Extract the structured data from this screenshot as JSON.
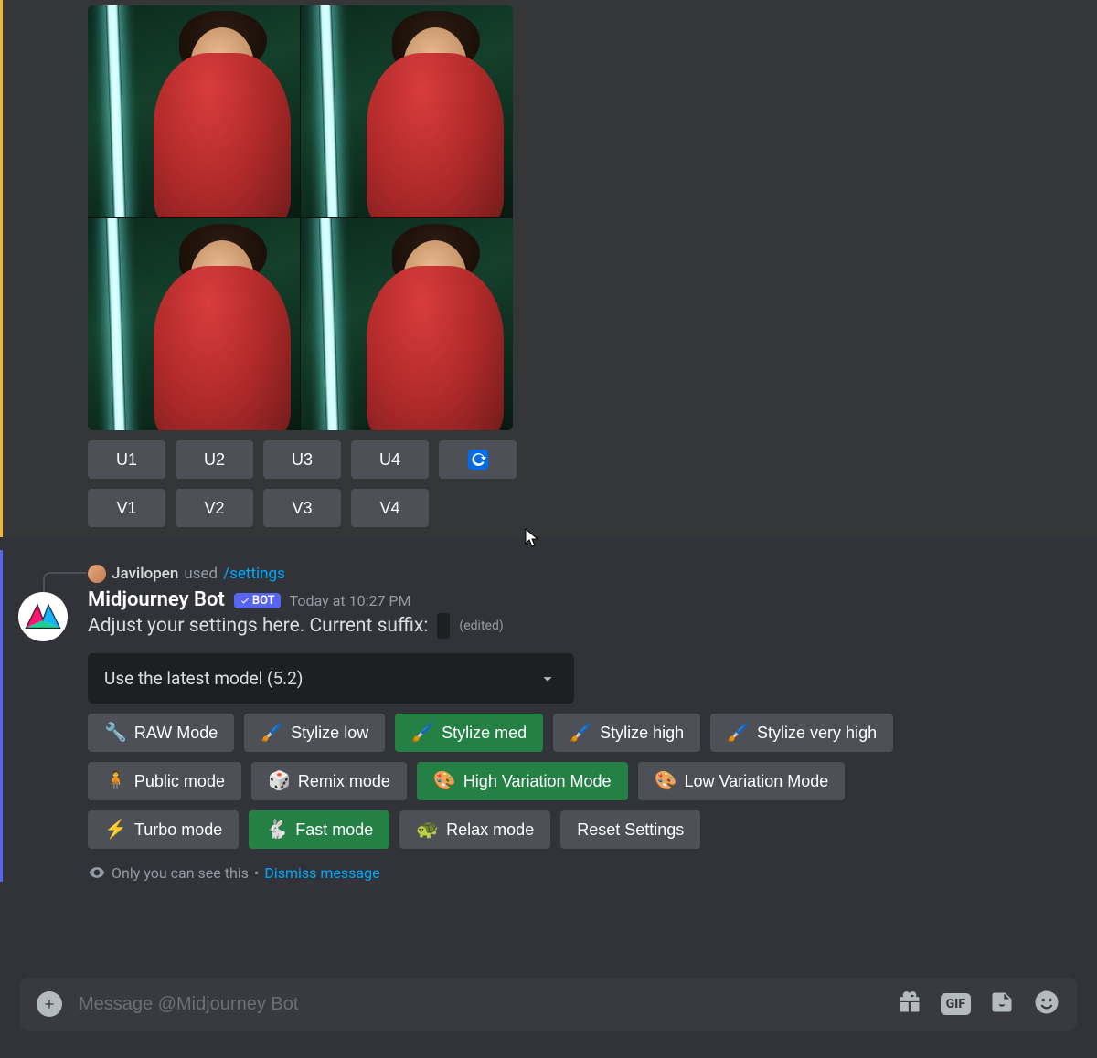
{
  "prior": {
    "u_buttons": [
      "U1",
      "U2",
      "U3",
      "U4"
    ],
    "v_buttons": [
      "V1",
      "V2",
      "V3",
      "V4"
    ]
  },
  "reply": {
    "user": "Javilopen",
    "verb": "used",
    "command": "/settings"
  },
  "bot": {
    "name": "Midjourney Bot",
    "tag": "BOT",
    "timestamp": "Today at 10:27 PM",
    "text": "Adjust your settings here. Current suffix:",
    "edited": "(edited)"
  },
  "select": {
    "value": "Use the latest model (5.2)"
  },
  "rows": {
    "row1": [
      {
        "emoji": "🔧",
        "label": "RAW Mode",
        "active": false
      },
      {
        "emoji": "🖌️",
        "label": "Stylize low",
        "active": false
      },
      {
        "emoji": "🖌️",
        "label": "Stylize med",
        "active": true
      },
      {
        "emoji": "🖌️",
        "label": "Stylize high",
        "active": false
      },
      {
        "emoji": "🖌️",
        "label": "Stylize very high",
        "active": false
      }
    ],
    "row2": [
      {
        "emoji": "🧍",
        "label": "Public mode",
        "active": false
      },
      {
        "emoji": "🎲",
        "label": "Remix mode",
        "active": false
      },
      {
        "emoji": "🎨",
        "label": "High Variation Mode",
        "active": true
      },
      {
        "emoji": "🎨",
        "label": "Low Variation Mode",
        "active": false
      }
    ],
    "row3": [
      {
        "emoji": "⚡",
        "label": "Turbo mode",
        "active": false
      },
      {
        "emoji": "🐇",
        "label": "Fast mode",
        "active": true
      },
      {
        "emoji": "🐢",
        "label": "Relax mode",
        "active": false
      },
      {
        "emoji": "",
        "label": "Reset Settings",
        "active": false
      }
    ]
  },
  "footer": {
    "private": "Only you can see this",
    "sep": "•",
    "dismiss": "Dismiss message"
  },
  "input": {
    "placeholder": "Message @Midjourney Bot",
    "gif": "GIF"
  }
}
